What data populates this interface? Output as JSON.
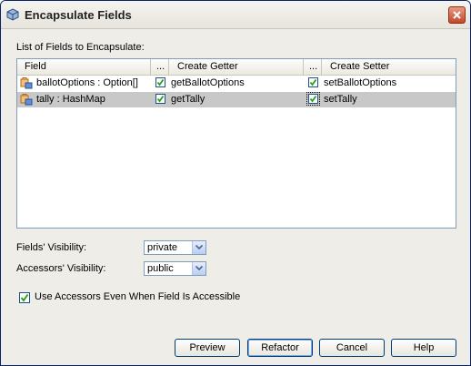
{
  "window": {
    "title": "Encapsulate Fields"
  },
  "list_label": "List of Fields to Encapsulate:",
  "table": {
    "columns": {
      "field": "Field",
      "dots1": "...",
      "getter": "Create Getter",
      "dots2": "...",
      "setter": "Create Setter"
    },
    "rows": [
      {
        "field": "ballotOptions : Option[]",
        "getter_checked": true,
        "getter": "getBallotOptions",
        "setter_checked": true,
        "setter": "setBallotOptions"
      },
      {
        "field": "tally : HashMap",
        "getter_checked": true,
        "getter": "getTally",
        "setter_checked": true,
        "setter": "setTally"
      }
    ]
  },
  "fields_visibility": {
    "label": "Fields' Visibility:",
    "value": "private"
  },
  "accessors_visibility": {
    "label": "Accessors' Visibility:",
    "value": "public"
  },
  "use_accessors": {
    "label": "Use Accessors Even When Field Is Accessible",
    "checked": true
  },
  "buttons": {
    "preview": "Preview",
    "refactor": "Refactor",
    "cancel": "Cancel",
    "help": "Help"
  },
  "colors": {
    "selected_row": "#c8c8c8",
    "border": "#7f9db9",
    "check": "#21a121"
  },
  "icons": {
    "title": "netbeans-cube-icon",
    "field": "field-lock-icon",
    "dropdown": "chevron-down-icon",
    "close": "close-icon"
  }
}
